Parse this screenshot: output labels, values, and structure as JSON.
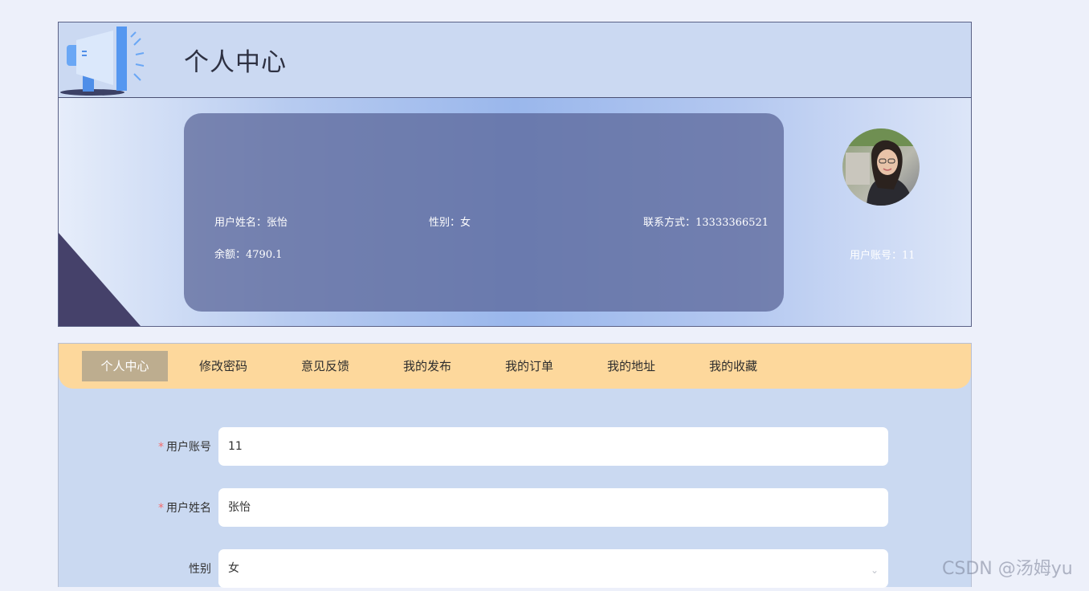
{
  "header": {
    "title": "个人中心",
    "icon": "megaphone-icon"
  },
  "profile": {
    "name_label": "用户姓名：",
    "name_value": "张怡",
    "gender_label": "性别：",
    "gender_value": "女",
    "phone_label": "联系方式：",
    "phone_value": "13333366521",
    "balance_label": "余额：",
    "balance_value": "4790.1",
    "account_label": "用户账号：",
    "account_value": "11"
  },
  "tabs": [
    {
      "label": "个人中心",
      "active": true
    },
    {
      "label": "修改密码",
      "active": false
    },
    {
      "label": "意见反馈",
      "active": false
    },
    {
      "label": "我的发布",
      "active": false
    },
    {
      "label": "我的订单",
      "active": false
    },
    {
      "label": "我的地址",
      "active": false
    },
    {
      "label": "我的收藏",
      "active": false
    }
  ],
  "form": {
    "fields": [
      {
        "label": "用户账号",
        "required": true,
        "value": "11"
      },
      {
        "label": "用户姓名",
        "required": true,
        "value": "张怡"
      },
      {
        "label": "性别",
        "required": false,
        "value": "女"
      }
    ]
  },
  "watermark": "CSDN @汤姆yu",
  "colors": {
    "tabbar": "#fdd89c",
    "active_tab": "#bdad8f",
    "panel": "#cad9f1",
    "card": "#5a6298",
    "required": "#f56c6c"
  }
}
